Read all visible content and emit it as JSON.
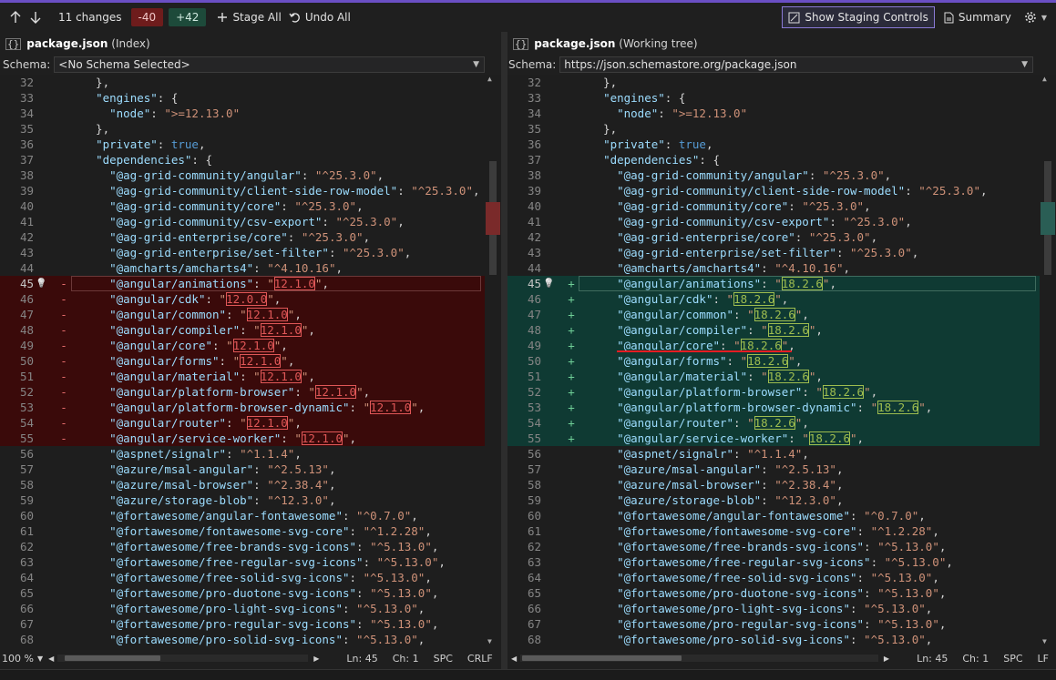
{
  "toolbar": {
    "changes_label": "11 changes",
    "removed": "-40",
    "added": "+42",
    "stage_all": "Stage All",
    "undo_all": "Undo All",
    "show_staging": "Show Staging Controls",
    "summary": "Summary"
  },
  "colors": {
    "removed_bg": "#3a0a0a",
    "added_bg": "#0f3a33",
    "accent": "#6a4fc4",
    "removed_box": "#e05757",
    "added_box": "#9ebd4f"
  },
  "left": {
    "file": "package.json",
    "qualifier": "(Index)",
    "schema_label": "Schema:",
    "schema_value": "<No Schema Selected>",
    "status": {
      "zoom": "100 %",
      "ln": "Ln: 45",
      "ch": "Ch: 1",
      "spc": "SPC",
      "eol": "CRLF"
    }
  },
  "right": {
    "file": "package.json",
    "qualifier": "(Working tree)",
    "schema_label": "Schema:",
    "schema_value": "https://json.schemastore.org/package.json",
    "status": {
      "ln": "Ln: 45",
      "ch": "Ch: 1",
      "spc": "SPC",
      "eol": "LF"
    }
  },
  "lines": [
    {
      "n": "32",
      "indent": "  ",
      "text": "},"
    },
    {
      "n": "33",
      "indent": "  ",
      "key": "engines",
      "after": ": {"
    },
    {
      "n": "34",
      "indent": "    ",
      "key": "node",
      "val": ">=12.13.0",
      "after": ""
    },
    {
      "n": "35",
      "indent": "  ",
      "text": "},"
    },
    {
      "n": "36",
      "indent": "  ",
      "key": "private",
      "bool": "true",
      "after": ","
    },
    {
      "n": "37",
      "indent": "  ",
      "key": "dependencies",
      "after": ": {"
    },
    {
      "n": "38",
      "indent": "    ",
      "key": "@ag-grid-community/angular",
      "val": "^25.3.0",
      "after": ","
    },
    {
      "n": "39",
      "indent": "    ",
      "key": "@ag-grid-community/client-side-row-model",
      "val": "^25.3.0",
      "after": ","
    },
    {
      "n": "40",
      "indent": "    ",
      "key": "@ag-grid-community/core",
      "val": "^25.3.0",
      "after": ","
    },
    {
      "n": "41",
      "indent": "    ",
      "key": "@ag-grid-community/csv-export",
      "val": "^25.3.0",
      "after": ","
    },
    {
      "n": "42",
      "indent": "    ",
      "key": "@ag-grid-enterprise/core",
      "val": "^25.3.0",
      "after": ","
    },
    {
      "n": "43",
      "indent": "    ",
      "key": "@ag-grid-enterprise/set-filter",
      "val": "^25.3.0",
      "after": ","
    },
    {
      "n": "44",
      "indent": "    ",
      "key": "@amcharts/amcharts4",
      "val": "^4.10.16",
      "after": ","
    },
    {
      "n": "45",
      "indent": "    ",
      "key": "@angular/animations",
      "old": "12.1.0",
      "new": "18.2.6",
      "after": ","
    },
    {
      "n": "46",
      "indent": "    ",
      "key": "@angular/cdk",
      "old": "12.0.0",
      "new": "18.2.6",
      "after": ","
    },
    {
      "n": "47",
      "indent": "    ",
      "key": "@angular/common",
      "old": "12.1.0",
      "new": "18.2.6",
      "after": ","
    },
    {
      "n": "48",
      "indent": "    ",
      "key": "@angular/compiler",
      "old": "12.1.0",
      "new": "18.2.6",
      "after": ","
    },
    {
      "n": "49",
      "indent": "    ",
      "key": "@angular/core",
      "old": "12.1.0",
      "new": "18.2.6",
      "after": ","
    },
    {
      "n": "50",
      "indent": "    ",
      "key": "@angular/forms",
      "old": "12.1.0",
      "new": "18.2.6",
      "after": ","
    },
    {
      "n": "51",
      "indent": "    ",
      "key": "@angular/material",
      "old": "12.1.0",
      "new": "18.2.6",
      "after": ","
    },
    {
      "n": "52",
      "indent": "    ",
      "key": "@angular/platform-browser",
      "old": "12.1.0",
      "new": "18.2.6",
      "after": ","
    },
    {
      "n": "53",
      "indent": "    ",
      "key": "@angular/platform-browser-dynamic",
      "old": "12.1.0",
      "new": "18.2.6",
      "after": ","
    },
    {
      "n": "54",
      "indent": "    ",
      "key": "@angular/router",
      "old": "12.1.0",
      "new": "18.2.6",
      "after": ","
    },
    {
      "n": "55",
      "indent": "    ",
      "key": "@angular/service-worker",
      "old": "12.1.0",
      "new": "18.2.6",
      "after": ","
    },
    {
      "n": "56",
      "indent": "    ",
      "key": "@aspnet/signalr",
      "val": "^1.1.4",
      "after": ","
    },
    {
      "n": "57",
      "indent": "    ",
      "key": "@azure/msal-angular",
      "val": "^2.5.13",
      "after": ","
    },
    {
      "n": "58",
      "indent": "    ",
      "key": "@azure/msal-browser",
      "val": "^2.38.4",
      "after": ","
    },
    {
      "n": "59",
      "indent": "    ",
      "key": "@azure/storage-blob",
      "val": "^12.3.0",
      "after": ","
    },
    {
      "n": "60",
      "indent": "    ",
      "key": "@fortawesome/angular-fontawesome",
      "val": "^0.7.0",
      "after": ","
    },
    {
      "n": "61",
      "indent": "    ",
      "key": "@fortawesome/fontawesome-svg-core",
      "val": "^1.2.28",
      "after": ","
    },
    {
      "n": "62",
      "indent": "    ",
      "key": "@fortawesome/free-brands-svg-icons",
      "val": "^5.13.0",
      "after": ","
    },
    {
      "n": "63",
      "indent": "    ",
      "key": "@fortawesome/free-regular-svg-icons",
      "val": "^5.13.0",
      "after": ","
    },
    {
      "n": "64",
      "indent": "    ",
      "key": "@fortawesome/free-solid-svg-icons",
      "val": "^5.13.0",
      "after": ","
    },
    {
      "n": "65",
      "indent": "    ",
      "key": "@fortawesome/pro-duotone-svg-icons",
      "val": "^5.13.0",
      "after": ","
    },
    {
      "n": "66",
      "indent": "    ",
      "key": "@fortawesome/pro-light-svg-icons",
      "val": "^5.13.0",
      "after": ","
    },
    {
      "n": "67",
      "indent": "    ",
      "key": "@fortawesome/pro-regular-svg-icons",
      "val": "^5.13.0",
      "after": ","
    },
    {
      "n": "68",
      "indent": "    ",
      "key": "@fortawesome/pro-solid-svg-icons",
      "val": "^5.13.0",
      "after": ","
    }
  ]
}
